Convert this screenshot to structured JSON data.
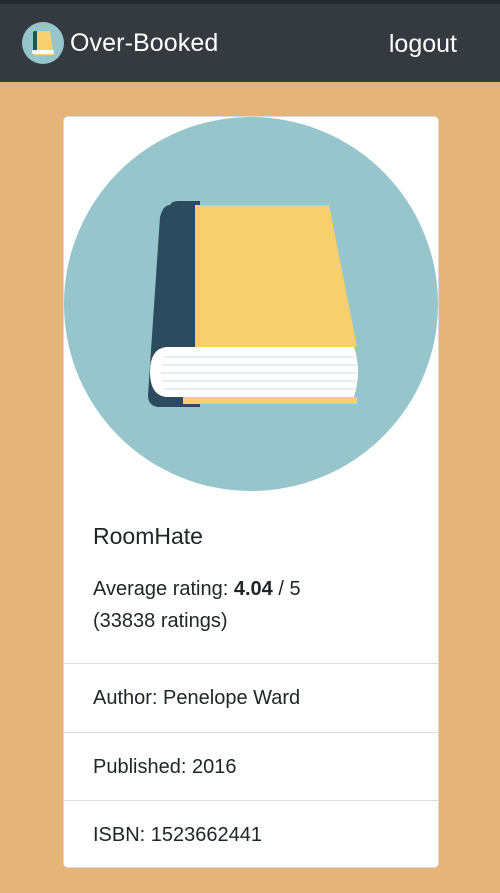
{
  "navbar": {
    "brand": "Over-Booked",
    "logout_label": "logout"
  },
  "book": {
    "title": "RoomHate",
    "rating_label": "Average rating:",
    "rating_value": "4.04",
    "rating_max": "/ 5",
    "ratings_count": "(33838 ratings)",
    "author": "Author: Penelope Ward",
    "published": "Published: 2016",
    "isbn": "ISBN: 1523662441"
  },
  "colors": {
    "page_bg": "#e5b479",
    "navbar_bg": "#343a40",
    "cover_circle": "#96c5cc",
    "book_cover": "#f8cf6e",
    "book_spine": "#2d4b5e"
  },
  "icons": {
    "brand": "book-icon",
    "cover": "book-illustration"
  }
}
